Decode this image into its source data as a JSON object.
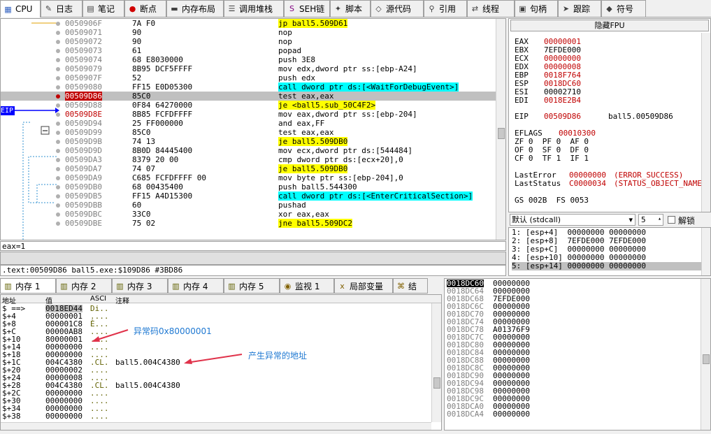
{
  "tabs": [
    {
      "label": "CPU",
      "icon": "cpu-icon",
      "active": true
    },
    {
      "label": "日志",
      "icon": "log-icon"
    },
    {
      "label": "笔记",
      "icon": "notes-icon"
    },
    {
      "label": "断点",
      "icon": "breakpoint-icon"
    },
    {
      "label": "内存布局",
      "icon": "memory-map-icon"
    },
    {
      "label": "调用堆栈",
      "icon": "callstack-icon"
    },
    {
      "label": "SEH链",
      "icon": "seh-icon"
    },
    {
      "label": "脚本",
      "icon": "script-icon"
    },
    {
      "label": "源代码",
      "icon": "source-icon"
    },
    {
      "label": "引用",
      "icon": "references-icon"
    },
    {
      "label": "线程",
      "icon": "threads-icon"
    },
    {
      "label": "句柄",
      "icon": "handles-icon"
    },
    {
      "label": "跟踪",
      "icon": "trace-icon"
    },
    {
      "label": "符号",
      "icon": "symbols-icon"
    }
  ],
  "eip_label": "EIP",
  "disasm": [
    {
      "addr": "0050906F",
      "bytes": "7A F0",
      "asm": "jp ball5.509D61",
      "hl": "jmp"
    },
    {
      "addr": "00509071",
      "bytes": "90",
      "asm": "nop"
    },
    {
      "addr": "00509072",
      "bytes": "90",
      "asm": "nop"
    },
    {
      "addr": "00509073",
      "bytes": "61",
      "asm": "popad"
    },
    {
      "addr": "00509074",
      "bytes": "68 E8030000",
      "asm": "push 3E8"
    },
    {
      "addr": "00509079",
      "bytes": "8B95 DCF5FFFF",
      "asm": "mov edx,dword ptr ss:[ebp-A24]"
    },
    {
      "addr": "0050907F",
      "bytes": "52",
      "asm": "push edx"
    },
    {
      "addr": "00509080",
      "bytes": "FF15 E0D05300",
      "asm": "call dword ptr ds:[<WaitForDebugEvent>]",
      "hl": "call"
    },
    {
      "addr": "00509D86",
      "bytes": "85C0",
      "asm": "test eax,eax",
      "cur": true
    },
    {
      "addr": "00509D88",
      "bytes": "0F84 64270000",
      "asm": "je <ball5.sub_50C4F2>",
      "hl": "jmp"
    },
    {
      "addr": "00509D8E",
      "bytes": "8B85 FCFDFFFF",
      "asm": "mov eax,dword ptr ss:[ebp-204]",
      "red": true
    },
    {
      "addr": "00509D94",
      "bytes": "25 FF000000",
      "asm": "and eax,FF"
    },
    {
      "addr": "00509D99",
      "bytes": "85C0",
      "asm": "test eax,eax"
    },
    {
      "addr": "00509D9B",
      "bytes": "74 13",
      "asm": "je ball5.509DB0",
      "hl": "jmp"
    },
    {
      "addr": "00509D9D",
      "bytes": "8B0D 84445400",
      "asm": "mov ecx,dword ptr ds:[544484]"
    },
    {
      "addr": "00509DA3",
      "bytes": "8379 20 00",
      "asm": "cmp dword ptr ds:[ecx+20],0"
    },
    {
      "addr": "00509DA7",
      "bytes": "74 07",
      "asm": "je ball5.509DB0",
      "hl": "jmp"
    },
    {
      "addr": "00509DA9",
      "bytes": "C685 FCFDFFFF 00",
      "asm": "mov byte ptr ss:[ebp-204],0"
    },
    {
      "addr": "00509DB0",
      "bytes": "68 00435400",
      "asm": "push ball5.544300"
    },
    {
      "addr": "00509DB5",
      "bytes": "FF15 A4D15300",
      "asm": "call dword ptr ds:[<EnterCriticalSection>]",
      "hl": "call"
    },
    {
      "addr": "00509DBB",
      "bytes": "60",
      "asm": "pushad"
    },
    {
      "addr": "00509DBC",
      "bytes": "33C0",
      "asm": "xor eax,eax"
    },
    {
      "addr": "00509DBE",
      "bytes": "75 02",
      "asm": "jne ball5.509DC2",
      "hl": "jmp"
    }
  ],
  "info": {
    "line1": "eax=1",
    "line3": ".text:00509D86 ball5.exe:$109D86 #3BD86"
  },
  "regs": {
    "fpu_button": "隐藏FPU",
    "gp": [
      {
        "n": "EAX",
        "v": "00000001",
        "red": true
      },
      {
        "n": "EBX",
        "v": "7EFDE000"
      },
      {
        "n": "ECX",
        "v": "00000000",
        "red": true
      },
      {
        "n": "EDX",
        "v": "00000008",
        "red": true
      },
      {
        "n": "EBP",
        "v": "0018F764",
        "red": true
      },
      {
        "n": "ESP",
        "v": "0018DC60",
        "red": true
      },
      {
        "n": "ESI",
        "v": "00002710"
      },
      {
        "n": "EDI",
        "v": "0018E2B4",
        "red": true
      }
    ],
    "eip": {
      "n": "EIP",
      "v": "00509D86",
      "sym": "ball5.00509D86"
    },
    "eflags": {
      "n": "EFLAGS",
      "v": "00010300"
    },
    "flags1": "ZF 0  PF 0  AF 0",
    "flags2": "OF 0  SF 0  DF 0",
    "flags3": "CF 0  TF 1  IF 1",
    "lasterror": {
      "n": "LastError",
      "v": "00000000",
      "s": "(ERROR_SUCCESS)"
    },
    "laststatus": {
      "n": "LastStatus",
      "v": "C0000034",
      "s": "(STATUS_OBJECT_NAME"
    },
    "seg": "GS 002B  FS 0053"
  },
  "callconv": {
    "selected": "默认 (stdcall)",
    "count": "5",
    "unlock": "解锁"
  },
  "callstack": [
    "1: [esp+4]  00000000 00000000",
    "2: [esp+8]  7EFDE000 7EFDE000",
    "3: [esp+C]  00000000 00000000",
    "4: [esp+10] 00000000 00000000",
    "5: [esp+14] 00000000 00000000"
  ],
  "btabs": [
    {
      "label": "内存 1",
      "icon": "memory-icon",
      "active": true
    },
    {
      "label": "内存 2",
      "icon": "memory-icon"
    },
    {
      "label": "内存 3",
      "icon": "memory-icon"
    },
    {
      "label": "内存 4",
      "icon": "memory-icon"
    },
    {
      "label": "内存 5",
      "icon": "memory-icon"
    },
    {
      "label": "监视 1",
      "icon": "watch-icon"
    },
    {
      "label": "局部变量",
      "icon": "locals-icon"
    },
    {
      "label": "结",
      "icon": "struct-icon"
    }
  ],
  "dump": {
    "headers": [
      "地址",
      "值",
      "ASCI",
      "注释"
    ],
    "rows": [
      {
        "a": "$ ==>",
        "v": "0018ED44",
        "s": "Di..",
        "c": ""
      },
      {
        "a": "$+4",
        "v": "00000001",
        "s": "....",
        "c": ""
      },
      {
        "a": "$+8",
        "v": "000001C8",
        "s": "È...",
        "c": ""
      },
      {
        "a": "$+C",
        "v": "00000AB8",
        "s": "....",
        "c": ""
      },
      {
        "a": "$+10",
        "v": "80000001",
        "s": "....",
        "c": ""
      },
      {
        "a": "$+14",
        "v": "00000000",
        "s": "....",
        "c": ""
      },
      {
        "a": "$+18",
        "v": "00000000",
        "s": "....",
        "c": ""
      },
      {
        "a": "$+1C",
        "v": "004C4380",
        "s": ".CL.",
        "c": "ball5.004C4380"
      },
      {
        "a": "$+20",
        "v": "00000002",
        "s": "....",
        "c": ""
      },
      {
        "a": "$+24",
        "v": "00000008",
        "s": "....",
        "c": ""
      },
      {
        "a": "$+28",
        "v": "004C4380",
        "s": ".CL.",
        "c": "ball5.004C4380"
      },
      {
        "a": "$+2C",
        "v": "00000000",
        "s": "....",
        "c": ""
      },
      {
        "a": "$+30",
        "v": "00000000",
        "s": "....",
        "c": ""
      },
      {
        "a": "$+34",
        "v": "00000000",
        "s": "....",
        "c": ""
      },
      {
        "a": "$+38",
        "v": "00000000",
        "s": "....",
        "c": ""
      }
    ],
    "annotations": [
      "异常码0x80000001",
      "产生异常的地址"
    ]
  },
  "stack": [
    {
      "a": "0018DC60",
      "v": "00000000",
      "cur": true
    },
    {
      "a": "0018DC64",
      "v": "00000000"
    },
    {
      "a": "0018DC68",
      "v": "7EFDE000"
    },
    {
      "a": "0018DC6C",
      "v": "00000000"
    },
    {
      "a": "0018DC70",
      "v": "00000000"
    },
    {
      "a": "0018DC74",
      "v": "00000000"
    },
    {
      "a": "0018DC78",
      "v": "A01376F9"
    },
    {
      "a": "0018DC7C",
      "v": "00000000"
    },
    {
      "a": "0018DC80",
      "v": "00000000"
    },
    {
      "a": "0018DC84",
      "v": "00000000"
    },
    {
      "a": "0018DC88",
      "v": "00000000"
    },
    {
      "a": "0018DC8C",
      "v": "00000000"
    },
    {
      "a": "0018DC90",
      "v": "00000000"
    },
    {
      "a": "0018DC94",
      "v": "00000000"
    },
    {
      "a": "0018DC98",
      "v": "00000000"
    },
    {
      "a": "0018DC9C",
      "v": "00000000"
    },
    {
      "a": "0018DCA0",
      "v": "00000000"
    },
    {
      "a": "0018DCA4",
      "v": "00000000"
    }
  ],
  "colors": {
    "accent": "#0000ff",
    "current_row": "#c0c0c0",
    "highlight": "#ffff00",
    "call": "#00ffff"
  }
}
